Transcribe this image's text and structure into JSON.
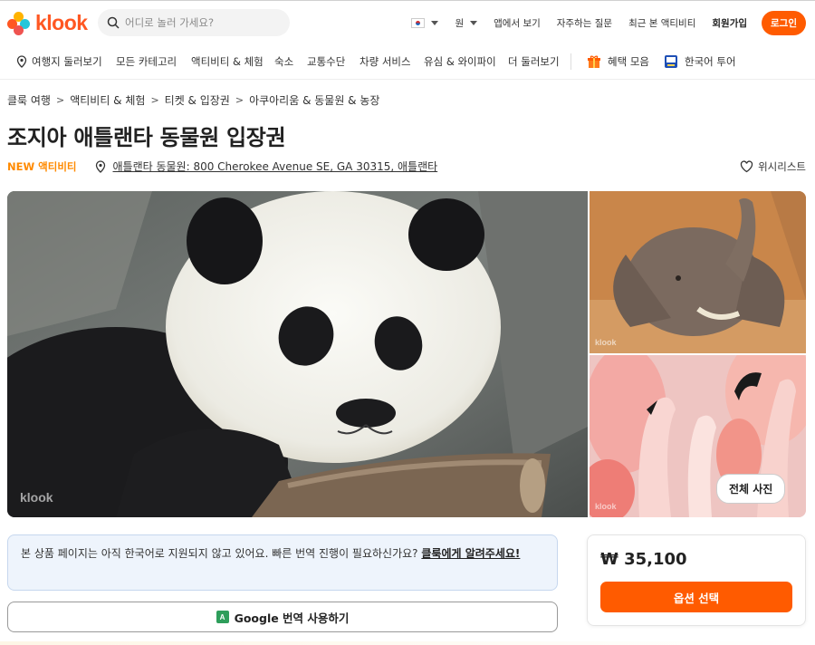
{
  "brand": {
    "logo_text": "klook",
    "colors": {
      "accent": "#ff5b00",
      "new_badge": "#ff8a00",
      "notice_bg": "#eef4fc"
    }
  },
  "header": {
    "search_placeholder": "어디로 놀러 가세요?",
    "currency": "원",
    "links": [
      "앱에서 보기",
      "자주하는 질문",
      "최근 본 액티비티",
      "회원가입"
    ],
    "login": "로그인"
  },
  "nav": {
    "items": [
      "여행지 둘러보기",
      "모든 카테고리",
      "액티비티 & 체험",
      "숙소",
      "교통수단",
      "차량 서비스",
      "유심 & 와이파이",
      "더 둘러보기"
    ],
    "deals": "혜택 모음",
    "korean_tour": "한국어 투어"
  },
  "breadcrumb": [
    "클룩 여행",
    "액티비티 & 체험",
    "티켓 & 입장권",
    "아쿠아리움 & 동물원 & 농장"
  ],
  "product": {
    "title": "조지아 애틀랜타 동물원 입장권",
    "badge": "NEW 액티비티",
    "location": "애틀랜타 동물원: 800 Cherokee Avenue SE, GA 30315, 애틀랜타",
    "wishlist": "위시리스트",
    "all_photos": "전체 사진",
    "watermark": "klook"
  },
  "notice": {
    "text": "본 상품 페이지는 아직 한국어로 지원되지 않고 있어요. 빠른 번역 진행이 필요하신가요? ",
    "link": "클룩에게 알려주세요!"
  },
  "google_translate": "Google 번역 사용하기",
  "pricing": {
    "price": "₩ 35,100",
    "select_option": "옵션 선택"
  },
  "icons": [
    "search-icon",
    "korea-flag-icon",
    "chevron-down-icon",
    "location-pin-icon",
    "gift-icon",
    "korean-tour-icon",
    "chevron-right-icon",
    "heart-icon",
    "google-translate-icon"
  ]
}
